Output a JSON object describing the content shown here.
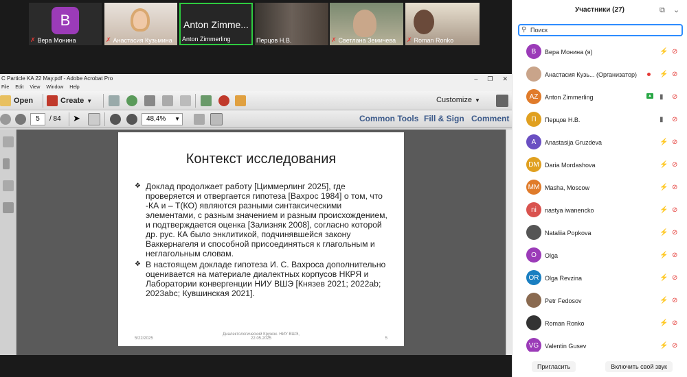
{
  "video_strip": [
    {
      "name": "Вера Монина",
      "letter": "B",
      "color": "#9b3bb8",
      "type": "letter"
    },
    {
      "name": "Анастасия Кузьмина",
      "type": "photo"
    },
    {
      "name": "Anton Zimmerling",
      "big": "Anton Zimme...",
      "type": "name"
    },
    {
      "name": "Перцов Н.В.",
      "type": "photo"
    },
    {
      "name": "Светлана Земичева",
      "type": "photo"
    },
    {
      "name": "Roman Ronko",
      "type": "photo"
    }
  ],
  "acrobat": {
    "title": "C Particle KA 22 May.pdf - Adobe Acrobat Pro",
    "menu": [
      "File",
      "Edit",
      "View",
      "Window",
      "Help"
    ],
    "open_label": "Open",
    "create_label": "Create",
    "customize_label": "Customize",
    "page_current": "5",
    "page_total": "/ 84",
    "zoom": "48,4%",
    "links": [
      "Common Tools",
      "Fill & Sign",
      "Comment"
    ]
  },
  "slide": {
    "title": "Контекст исследования",
    "bullet1": "Доклад продолжает работу [Циммерлинг 2025], где проверяется и отвергается гипотеза [Вахрос 1984] о том, что -КА и – Т(КО) являются разными синтаксическими элементами, с разным значением и разным происхождением, и подтверждается оценка [Зализняк 2008], согласно которой др. рус. КА было энклитикой, подчинявшейся закону Ваккернагеля и способной присоединяться к глагольным и неглагольным словам.",
    "bullet2": "В настоящем докладе гипотеза И. С. Вахроса дополнительно оценивается на материале диалектных корпусов НКРЯ и Лаборатории конвергенции НИУ ВШЭ [Князев 2021; 2022ab; 2023abc; Кувшинская 2021].",
    "footer_date": "5/22/2025",
    "footer_center": "Диалектологический Кружок. НИУ ВШЭ, 22.05.2025",
    "footer_page": "5"
  },
  "panel": {
    "title": "Участники (27)",
    "search_placeholder": "Поиск",
    "invite": "Пригласить",
    "unmute": "Включить свой звук",
    "participants": [
      {
        "name": "Вера Монина (я)",
        "initials": "В",
        "color": "#9b3bb8",
        "mic": "muted",
        "cam": "off"
      },
      {
        "name": "Анастасия Кузь... (Организатор)",
        "initials": "",
        "color": "#c9a48a",
        "mic": "muted",
        "cam": "off",
        "rec": true,
        "photo": true
      },
      {
        "name": "Anton Zimmerling",
        "initials": "AZ",
        "color": "#e07b2a",
        "mic": "on",
        "cam": "off",
        "share": true
      },
      {
        "name": "Перцов Н.В.",
        "initials": "П",
        "color": "#e0a020",
        "mic": "on",
        "cam": "off"
      },
      {
        "name": "Anastasija Gruzdeva",
        "initials": "A",
        "color": "#6a4fc2",
        "mic": "muted",
        "cam": "off"
      },
      {
        "name": "Daria Mordashova",
        "initials": "DM",
        "color": "#e0a020",
        "mic": "muted",
        "cam": "off"
      },
      {
        "name": "Masha, Moscow",
        "initials": "MM",
        "color": "#e07b2a",
        "mic": "muted",
        "cam": "off"
      },
      {
        "name": "nastya iwanencko",
        "initials": "ni",
        "color": "#d9534f",
        "mic": "muted",
        "cam": "off"
      },
      {
        "name": "Nataliia Popkova",
        "initials": "",
        "color": "#555",
        "mic": "muted",
        "cam": "off",
        "photo": true
      },
      {
        "name": "Olga",
        "initials": "O",
        "color": "#9b3bb8",
        "mic": "muted",
        "cam": "off"
      },
      {
        "name": "Olga Revzina",
        "initials": "OR",
        "color": "#1a7fc1",
        "mic": "muted",
        "cam": "off"
      },
      {
        "name": "Petr Fedosov",
        "initials": "",
        "color": "#8a6a50",
        "mic": "muted",
        "cam": "off",
        "photo": true
      },
      {
        "name": "Roman Ronko",
        "initials": "",
        "color": "#333",
        "mic": "muted",
        "cam": "off",
        "photo": true
      },
      {
        "name": "Valentin Gusev",
        "initials": "VG",
        "color": "#9b3bb8",
        "mic": "muted",
        "cam": "off"
      }
    ]
  }
}
